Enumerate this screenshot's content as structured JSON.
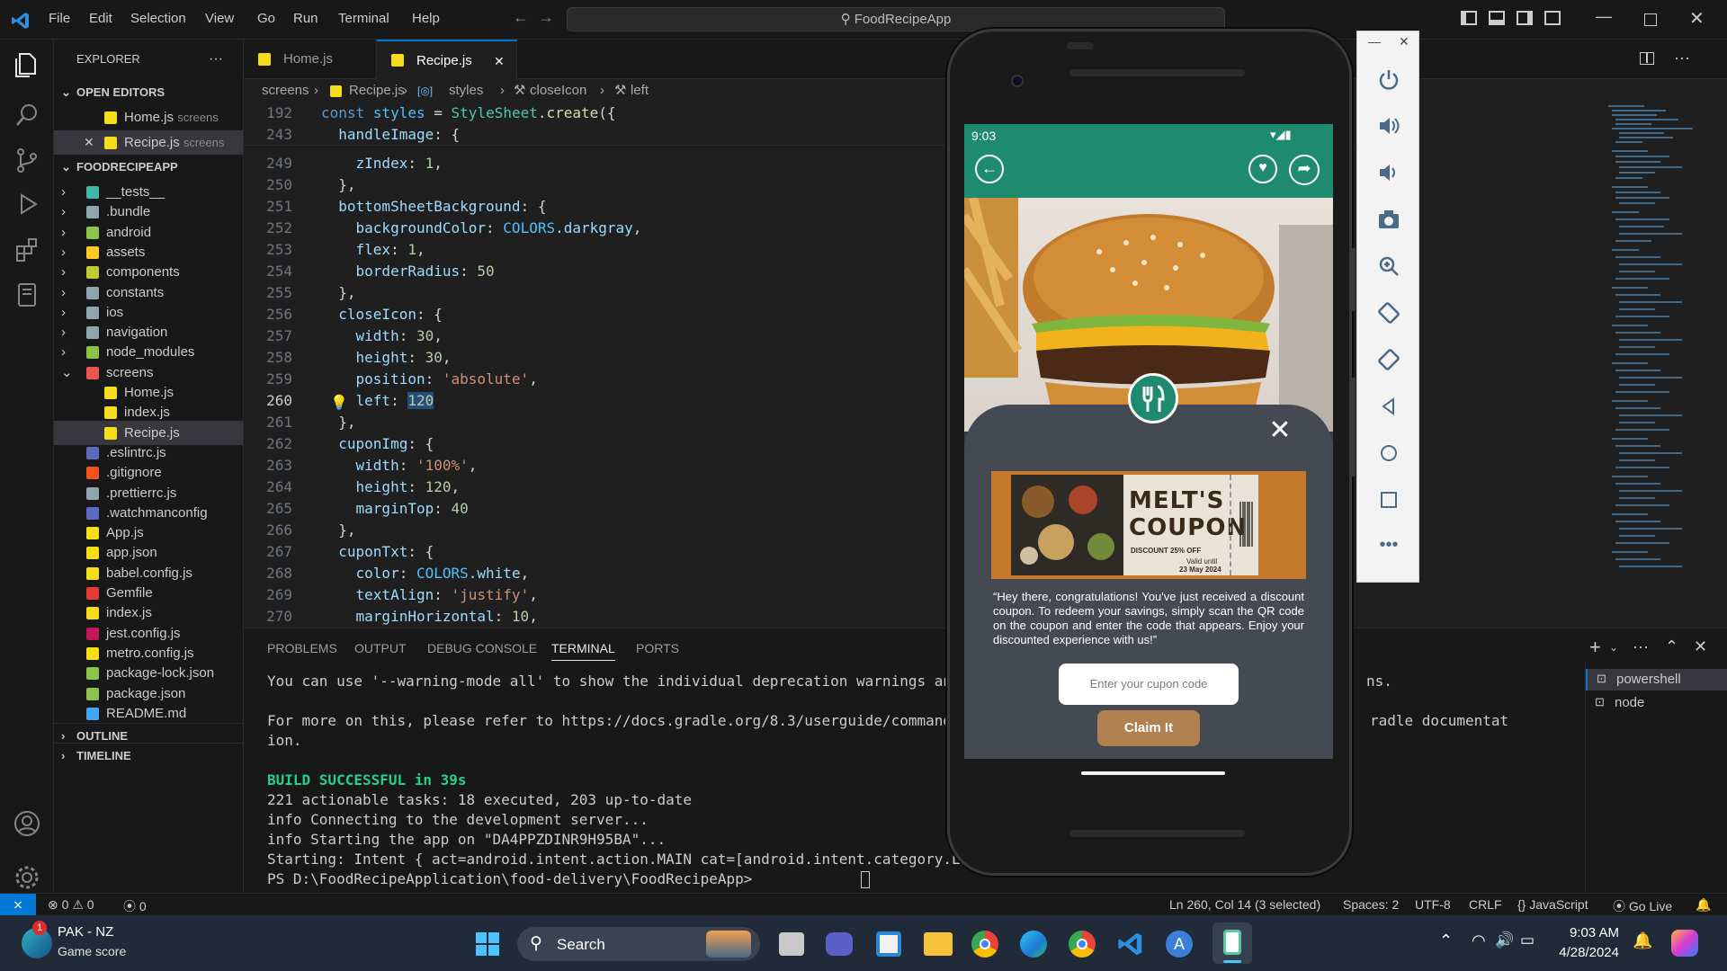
{
  "titlebar": {
    "menus": [
      "File",
      "Edit",
      "Selection",
      "View",
      "Go",
      "Run",
      "Terminal",
      "Help"
    ],
    "search": "FoodRecipeApp"
  },
  "sidebar": {
    "header": "EXPLORER",
    "open_editors_label": "OPEN EDITORS",
    "open_editors": [
      {
        "name": "Home.js",
        "hint": "screens"
      },
      {
        "name": "Recipe.js",
        "hint": "screens"
      }
    ],
    "project_label": "FOODRECIPEAPP",
    "tree": [
      {
        "name": "__tests__",
        "type": "folder",
        "color": "#3fb6a8"
      },
      {
        "name": ".bundle",
        "type": "folder",
        "color": "#90a4ae"
      },
      {
        "name": "android",
        "type": "folder",
        "color": "#8bc34a"
      },
      {
        "name": "assets",
        "type": "folder",
        "color": "#ffca28"
      },
      {
        "name": "components",
        "type": "folder",
        "color": "#c0ca33"
      },
      {
        "name": "constants",
        "type": "folder",
        "color": "#90a4ae"
      },
      {
        "name": "ios",
        "type": "folder",
        "color": "#90a4ae"
      },
      {
        "name": "navigation",
        "type": "folder",
        "color": "#90a4ae"
      },
      {
        "name": "node_modules",
        "type": "folder",
        "color": "#8bc34a"
      },
      {
        "name": "screens",
        "type": "folder-open",
        "color": "#ef5350"
      },
      {
        "name": "Home.js",
        "type": "js",
        "color": "#f5de19"
      },
      {
        "name": "index.js",
        "type": "js",
        "color": "#f5de19"
      },
      {
        "name": "Recipe.js",
        "type": "js",
        "color": "#f5de19"
      },
      {
        "name": ".eslintrc.js",
        "type": "file",
        "color": "#5c6bc0"
      },
      {
        "name": ".gitignore",
        "type": "file",
        "color": "#f4511e"
      },
      {
        "name": ".prettierrc.js",
        "type": "file",
        "color": "#90a4ae"
      },
      {
        "name": ".watchmanconfig",
        "type": "file",
        "color": "#5c6bc0"
      },
      {
        "name": "App.js",
        "type": "js",
        "color": "#f5de19"
      },
      {
        "name": "app.json",
        "type": "json",
        "color": "#f5de19"
      },
      {
        "name": "babel.config.js",
        "type": "file",
        "color": "#f5de19"
      },
      {
        "name": "Gemfile",
        "type": "file",
        "color": "#e53935"
      },
      {
        "name": "index.js",
        "type": "js",
        "color": "#f5de19"
      },
      {
        "name": "jest.config.js",
        "type": "file",
        "color": "#c2185b"
      },
      {
        "name": "metro.config.js",
        "type": "js",
        "color": "#f5de19"
      },
      {
        "name": "package-lock.json",
        "type": "file",
        "color": "#8bc34a"
      },
      {
        "name": "package.json",
        "type": "file",
        "color": "#8bc34a"
      },
      {
        "name": "README.md",
        "type": "file",
        "color": "#42a5f5"
      }
    ],
    "outline_label": "OUTLINE",
    "timeline_label": "TIMELINE"
  },
  "tabs": [
    {
      "label": "Home.js",
      "active": false
    },
    {
      "label": "Recipe.js",
      "active": true
    }
  ],
  "breadcrumb": [
    "screens",
    "Recipe.js",
    "styles",
    "closeIcon",
    "left"
  ],
  "editor": {
    "current_line": "260"
  },
  "panel": {
    "tabs": [
      "PROBLEMS",
      "OUTPUT",
      "DEBUG CONSOLE",
      "TERMINAL",
      "PORTS"
    ],
    "active_tab": "TERMINAL",
    "terminal_lines": [
      "You can use '--warning-mode all' to show the individual deprecation warnings and dete",
      "",
      "For more on this, please refer to https://docs.gradle.org/8.3/userguide/command_line",
      "ion.",
      "",
      "BUILD SUCCESSFUL in 39s",
      "221 actionable tasks: 18 executed, 203 up-to-date",
      "info Connecting to the development server...",
      "info Starting the app on \"DA4PPZDINR9H95BA\"...",
      "Starting: Intent { act=android.intent.action.MAIN cat=[android.intent.category.LAUNCH",
      "PS D:\\FoodRecipeApplication\\food-delivery\\FoodRecipeApp> "
    ],
    "terminal_right_1": "ns.",
    "terminal_right_2": "radle documentat",
    "terminals": [
      "powershell",
      "node"
    ]
  },
  "statusbar": {
    "errors": "0",
    "warnings": "0",
    "ports": "0",
    "position": "Ln 260, Col 14 (3 selected)",
    "spaces": "Spaces: 2",
    "encoding": "UTF-8",
    "eol": "CRLF",
    "language": "JavaScript",
    "golive": "Go Live"
  },
  "phone": {
    "time": "9:03",
    "coupon_title_1": "MELT'S",
    "coupon_title_2": "COUPON",
    "coupon_discount": "DISCOUNT 25% OFF",
    "coupon_valid": "Valid until",
    "coupon_date": "23 May 2024",
    "message": "“Hey there, congratulations! You've just received a discount coupon. To redeem your savings, simply scan the QR code on the coupon and enter the code that appears. Enjoy your discounted experience with us!”",
    "input_placeholder": "Enter your cupon code",
    "claim_label": "Claim It",
    "header_color": "#1e8a6e",
    "button_color": "#b08050"
  },
  "taskbar": {
    "weather_title": "PAK - NZ",
    "weather_sub": "Game score",
    "badge": "1",
    "search": "Search",
    "time": "9:03 AM",
    "date": "4/28/2024"
  }
}
